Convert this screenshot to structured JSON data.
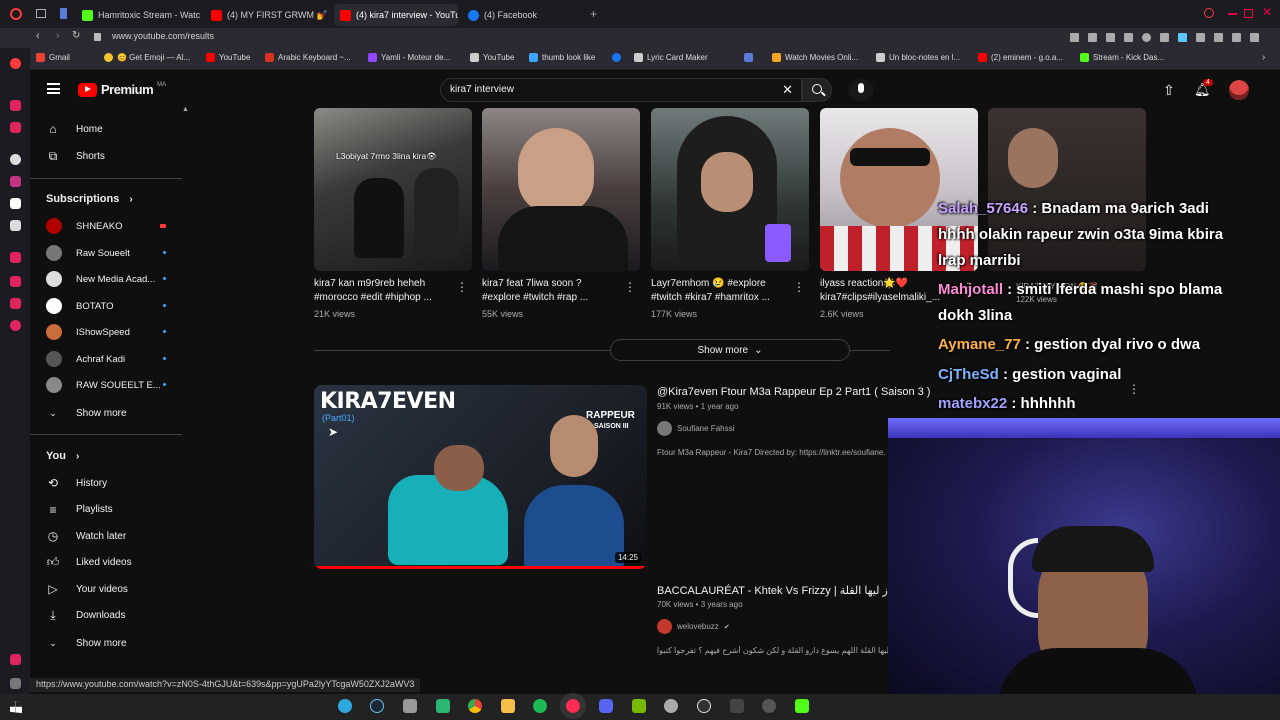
{
  "browser": {
    "tabs": [
      {
        "label": "Hamritoxic Stream - Watc",
        "color": "#53fc18"
      },
      {
        "label": "(4) MY FIRST GRWM 💅",
        "color": "#ff0000"
      },
      {
        "label": "(4) kira7 interview - YouTu",
        "color": "#ff0000"
      },
      {
        "label": "(4) Facebook",
        "color": "#1877f2"
      }
    ],
    "url": "www.youtube.com/results",
    "bookmarks": [
      {
        "label": "Gmail",
        "color": "#ea4335"
      },
      {
        "label": "😊 Get Emoji — Al...",
        "color": "#f4c430"
      },
      {
        "label": "YouTube",
        "color": "#ff0000"
      },
      {
        "label": "Arabic Keyboard ~...",
        "color": "#d93025"
      },
      {
        "label": "Yamli - Moteur de...",
        "color": "#9146ff"
      },
      {
        "label": "YouTube",
        "color": "#cccccc"
      },
      {
        "label": "thumb look like",
        "color": "#3ea6ff"
      },
      {
        "label": "Lyric Card Maker",
        "color": "#cccccc"
      },
      {
        "label": "Watch Movies Onli...",
        "color": "#f5a623"
      },
      {
        "label": "Un bloc-notes en l...",
        "color": "#cccccc"
      },
      {
        "label": "(2) eminem - g.o.a...",
        "color": "#ff0000"
      },
      {
        "label": "Stream - Kick Das...",
        "color": "#53fc18"
      }
    ],
    "status_url": "https://www.youtube.com/watch?v=zN0S-4thGJU&t=639s&pp=ygUPa2lyYTcgaW50ZXJ2aWV3"
  },
  "header": {
    "logo": "Premium",
    "logo_sup": "MA",
    "search_value": "kira7 interview",
    "notif_count": "4"
  },
  "sidebar": {
    "home": "Home",
    "shorts": "Shorts",
    "subscriptions": "Subscriptions",
    "subs": [
      {
        "label": "SHNEAKO",
        "color": "#b00000"
      },
      {
        "label": "Raw Soueelt",
        "color": "#777777"
      },
      {
        "label": "New Media Acad...",
        "color": "#dddddd"
      },
      {
        "label": "BOTATO",
        "color": "#ffffff"
      },
      {
        "label": "IShowSpeed",
        "color": "#c96d3a"
      },
      {
        "label": "Achraf Kadi",
        "color": "#555555"
      },
      {
        "label": "RAW SOUEELT E...",
        "color": "#888888"
      }
    ],
    "show_more": "Show more",
    "you": "You",
    "you_items": [
      "History",
      "Playlists",
      "Watch later",
      "Liked videos",
      "Your videos",
      "Downloads"
    ],
    "show_more_2": "Show more"
  },
  "shorts": [
    {
      "title": "kira7 kan m9r9reb heheh #morocco #edit #hiphop ...",
      "views": "21K views",
      "overlay": "L3obiyat 7rmo 3lina kira👁"
    },
    {
      "title": "kira7 feat 7liwa soon ? #explore #twitch #rap ...",
      "views": "55K views",
      "overlay": ""
    },
    {
      "title": "Layr7emhom 😢 #explore #twitch #kira7 #hamritox ...",
      "views": "177K views",
      "overlay": ""
    },
    {
      "title": "ilyass reaction🌟❤️ kira7#clips#ilyaselmaliki_...",
      "views": "2.6K views",
      "overlay": ""
    },
    {
      "title": "KIRA7 JAY VEW 😂🎉",
      "views": "122K views",
      "overlay": ""
    }
  ],
  "show_more_btn": "Show more",
  "videos": [
    {
      "title": "@Kira7even Ftour M3a Rappeur Ep 2 Part1 ( Saison 3 )",
      "meta": "91K views • 1 year ago",
      "channel": "Soufiane Fahssi",
      "desc": "Ftour M3a Rappeur - Kira7 Directed by: https://linktr.ee/soufiane.",
      "duration": "14:25",
      "thumb_text": "KIRA7EVEN",
      "thumb_sub": "(Part01)",
      "thumb_brand": "RAPPEUR",
      "thumb_season": "SAISON III"
    },
    {
      "title": "BACCALAURÉAT - Khtek Vs Frizzy | ز ليها القلة",
      "meta": "70K views • 3 years ago",
      "channel": "welovebuzz",
      "desc": "ليها القلة اللهم يسوع دارو القلة و لكن شكون أشرح فيهم ؟ تفرجوا كتبوا القناة الرسمية ل"
    }
  ],
  "chat": [
    {
      "user": "Salah_57646",
      "color": "#c8a2ff",
      "msg": " : Bnadam ma 9arich 3adi"
    },
    {
      "user": "",
      "color": "#ffffff",
      "msg": "hhhh olakin rapeur zwin o3ta 9ima kbira"
    },
    {
      "user": "",
      "color": "#ffffff",
      "msg": "lrap marribi"
    },
    {
      "user": "Mahjotall",
      "color": "#ff8ad8",
      "msg": " : smiti lferda mashi spo blama"
    },
    {
      "user": "",
      "color": "#ffffff",
      "msg": "dokh 3lina"
    },
    {
      "user": "Aymane_77",
      "color": "#ffb347",
      "msg": " : gestion dyal rivo o dwa"
    },
    {
      "user": "CjTheSd",
      "color": "#7fb2ff",
      "msg": " : gestion vaginal"
    },
    {
      "user": "matebx22",
      "color": "#a0a0ff",
      "msg": " : hhhhhh"
    }
  ]
}
